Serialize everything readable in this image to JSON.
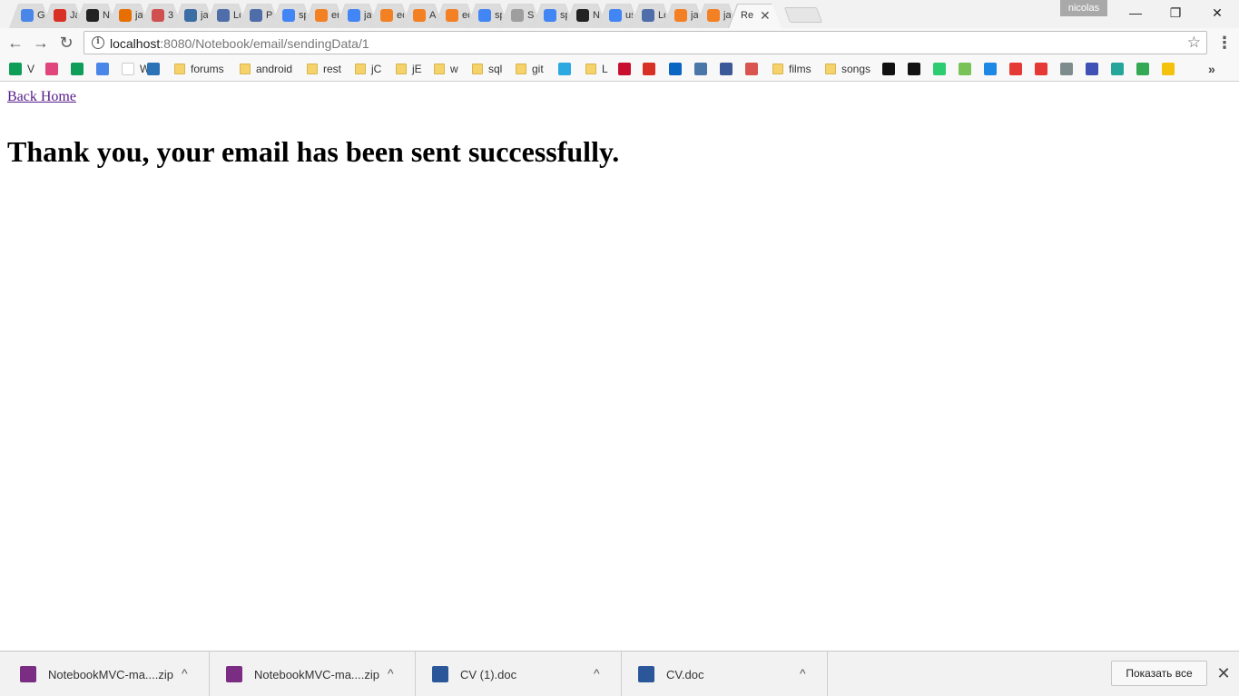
{
  "tabs": [
    {
      "title": "G",
      "favicon": "google-translate-icon",
      "color": "#4a86e8"
    },
    {
      "title": "Ja",
      "favicon": "gmail-icon",
      "color": "#d93025"
    },
    {
      "title": "N",
      "favicon": "github-icon",
      "color": "#222222"
    },
    {
      "title": "ja",
      "favicon": "java-icon",
      "color": "#e76f00"
    },
    {
      "title": "3",
      "favicon": "bookmark-red-icon",
      "color": "#d05050"
    },
    {
      "title": "ja",
      "favicon": "stackoverflow-icon",
      "color": "#3a6ea5"
    },
    {
      "title": "Lo",
      "favicon": "jira-icon",
      "color": "#4f6da8"
    },
    {
      "title": "Pa",
      "favicon": "jira-icon",
      "color": "#4f6da8"
    },
    {
      "title": "sp",
      "favicon": "google-icon",
      "color": "#4285f4"
    },
    {
      "title": "er",
      "favicon": "stackoverflow-icon",
      "color": "#f48024"
    },
    {
      "title": "ja",
      "favicon": "google-icon",
      "color": "#4285f4"
    },
    {
      "title": "ec",
      "favicon": "stackoverflow-icon",
      "color": "#f48024"
    },
    {
      "title": "A",
      "favicon": "stackoverflow-icon",
      "color": "#f48024"
    },
    {
      "title": "ec",
      "favicon": "stackoverflow-icon",
      "color": "#f48024"
    },
    {
      "title": "sp",
      "favicon": "google-icon",
      "color": "#4285f4"
    },
    {
      "title": "Sp",
      "favicon": "document-icon",
      "color": "#9e9e9e"
    },
    {
      "title": "sp",
      "favicon": "google-icon",
      "color": "#4285f4"
    },
    {
      "title": "N",
      "favicon": "github-icon",
      "color": "#222222"
    },
    {
      "title": "us",
      "favicon": "google-icon",
      "color": "#4285f4"
    },
    {
      "title": "Lo",
      "favicon": "jira-icon",
      "color": "#4f6da8"
    },
    {
      "title": "ja",
      "favicon": "stackoverflow-icon",
      "color": "#f48024"
    },
    {
      "title": "ja",
      "favicon": "stackoverflow-icon",
      "color": "#f48024"
    }
  ],
  "active_tab": {
    "title": "Re",
    "close": "✕"
  },
  "profile_name": "nicolas",
  "window": {
    "minimize": "—",
    "restore": "❐",
    "close": "✕"
  },
  "toolbar": {
    "back": "←",
    "forward": "→",
    "reload": "↻",
    "star": "☆",
    "menu": "⋮"
  },
  "address": {
    "host": "localhost",
    "path": ":8080/Notebook/email/sendingData/1"
  },
  "bookmarks": [
    {
      "label": "V",
      "icon": "sheets-icon",
      "color": "#0f9d58",
      "folder": false
    },
    {
      "label": "",
      "icon": "ribbon-icon",
      "color": "#e0457b",
      "folder": false
    },
    {
      "label": "",
      "icon": "sheets-icon",
      "color": "#0f9d58",
      "folder": false
    },
    {
      "label": "",
      "icon": "translate-icon",
      "color": "#4a86e8",
      "folder": false
    },
    {
      "label": "W",
      "icon": "wikipedia-icon",
      "color": "#ffffff",
      "folder": false
    },
    {
      "label": "",
      "icon": "edge-icon",
      "color": "#2b73b6",
      "folder": false
    },
    {
      "label": "forums",
      "icon": "folder-icon",
      "folder": true
    },
    {
      "label": "android",
      "icon": "folder-icon",
      "folder": true
    },
    {
      "label": "rest",
      "icon": "folder-icon",
      "folder": true
    },
    {
      "label": "jC",
      "icon": "folder-icon",
      "folder": true
    },
    {
      "label": "jE",
      "icon": "folder-icon",
      "folder": true
    },
    {
      "label": "w",
      "icon": "folder-icon",
      "folder": true
    },
    {
      "label": "sql",
      "icon": "folder-icon",
      "folder": true
    },
    {
      "label": "git",
      "icon": "folder-icon",
      "folder": true
    },
    {
      "label": "",
      "icon": "drupal-icon",
      "color": "#2ba9e0",
      "folder": false
    },
    {
      "label": "L",
      "icon": "folder-icon",
      "folder": true
    },
    {
      "label": "",
      "icon": "magnet-icon",
      "color": "#c8102e",
      "folder": false
    },
    {
      "label": "",
      "icon": "gmail-icon",
      "color": "#d93025",
      "folder": false
    },
    {
      "label": "",
      "icon": "linkedin-icon",
      "color": "#0a66c2",
      "folder": false
    },
    {
      "label": "",
      "icon": "vk-icon",
      "color": "#4a76a8",
      "folder": false
    },
    {
      "label": "",
      "icon": "facebook-icon",
      "color": "#3b5998",
      "folder": false
    },
    {
      "label": "",
      "icon": "calendar-icon",
      "color": "#d9534f",
      "folder": false
    },
    {
      "label": "films",
      "icon": "folder-icon",
      "folder": true
    },
    {
      "label": "songs",
      "icon": "folder-icon",
      "folder": true
    },
    {
      "label": "",
      "icon": "jr-icon",
      "color": "#111111",
      "folder": false
    },
    {
      "label": "",
      "icon": "jr-icon",
      "color": "#111111",
      "folder": false
    },
    {
      "label": "",
      "icon": "green-dots-icon",
      "color": "#2ecc71",
      "folder": false
    },
    {
      "label": "",
      "icon": "android-icon",
      "color": "#78c257",
      "folder": false
    },
    {
      "label": "",
      "icon": "d-icon",
      "color": "#1e88e5",
      "folder": false
    },
    {
      "label": "",
      "icon": "info-red-icon",
      "color": "#e53935",
      "folder": false
    },
    {
      "label": "",
      "icon": "flash-icon",
      "color": "#e53935",
      "folder": false
    },
    {
      "label": "",
      "icon": "gear-logo-icon",
      "color": "#7f8c8d",
      "folder": false
    },
    {
      "label": "",
      "icon": "scjp-icon",
      "color": "#3f51b5",
      "folder": false
    },
    {
      "label": "",
      "icon": "tree-icon",
      "color": "#26a69a",
      "folder": false
    },
    {
      "label": "",
      "icon": "maps-icon",
      "color": "#34a853",
      "folder": false
    },
    {
      "label": "",
      "icon": "heart-icon",
      "color": "#f4c20d",
      "folder": false
    }
  ],
  "bookmarks_more": "»",
  "page": {
    "back_home": "Back Home",
    "message": "Thank you, your email has been sent successfully."
  },
  "downloads": [
    {
      "filename": "NotebookMVC-ma....zip",
      "icon": "winrar-icon",
      "color": "#7b2c83"
    },
    {
      "filename": "NotebookMVC-ma....zip",
      "icon": "winrar-icon",
      "color": "#7b2c83"
    },
    {
      "filename": "CV (1).doc",
      "icon": "word-doc-icon",
      "color": "#2b579a"
    },
    {
      "filename": "CV.doc",
      "icon": "word-doc-icon",
      "color": "#2b579a"
    }
  ],
  "downloads_chevron": "^",
  "show_all": "Показать все",
  "shelf_close": "✕"
}
